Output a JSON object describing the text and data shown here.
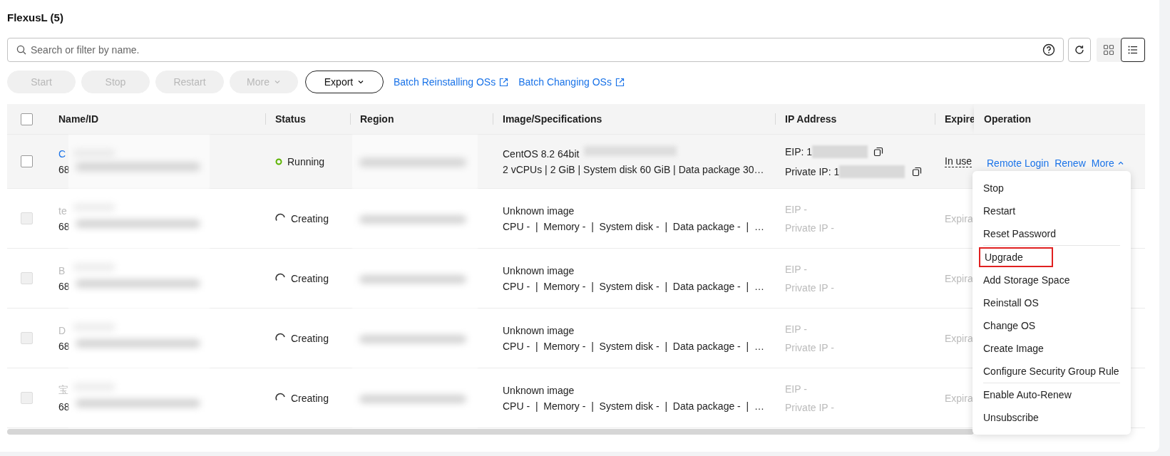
{
  "title": "FlexusL (5)",
  "search": {
    "placeholder": "Search or filter by name."
  },
  "view_toggle": [
    {
      "kind": "grid",
      "selected": false
    },
    {
      "kind": "list",
      "selected": true
    }
  ],
  "toolbar": {
    "buttons": [
      {
        "label": "Start",
        "disabled": true,
        "dropdown": false
      },
      {
        "label": "Stop",
        "disabled": true,
        "dropdown": false
      },
      {
        "label": "Restart",
        "disabled": true,
        "dropdown": false
      },
      {
        "label": "More",
        "disabled": true,
        "dropdown": true
      },
      {
        "label": "Export",
        "disabled": false,
        "dropdown": true
      }
    ],
    "links": [
      "Batch Reinstalling OSs",
      "Batch Changing OSs"
    ]
  },
  "table": {
    "select_all": {
      "checked": false
    },
    "columns": [
      "Name/ID",
      "Status",
      "Region",
      "Image/Specifications",
      "IP Address",
      "Expire",
      "Operation"
    ],
    "rows": [
      {
        "name": "C",
        "id": "68",
        "disabled": false,
        "hover": true,
        "status": {
          "kind": "running",
          "label": "Running"
        },
        "image": "CentOS 8.2 64bit",
        "specs": "2 vCPUs | 2 GiB | System disk 60 GiB | Data package 30…",
        "eip": "EIP: 1",
        "private_ip": "Private IP: 1",
        "ip_copy": true,
        "expire": "In use",
        "operations": [
          "Remote Login",
          "Renew",
          "More"
        ]
      },
      {
        "name": "te",
        "id": "68",
        "disabled": true,
        "hover": false,
        "status": {
          "kind": "creating",
          "label": "Creating"
        },
        "image": "Unknown image",
        "specs": "CPU -  |  Memory -  |  System disk -  |  Data package -  |  …",
        "eip": "EIP -",
        "private_ip": "Private IP -",
        "ip_copy": false,
        "expire": "Expira"
      },
      {
        "name": "B",
        "id": "68",
        "disabled": true,
        "hover": false,
        "status": {
          "kind": "creating",
          "label": "Creating"
        },
        "image": "Unknown image",
        "specs": "CPU -  |  Memory -  |  System disk -  |  Data package -  |  …",
        "eip": "EIP -",
        "private_ip": "Private IP -",
        "ip_copy": false,
        "expire": "Expira"
      },
      {
        "name": "D",
        "id": "68",
        "disabled": true,
        "hover": false,
        "status": {
          "kind": "creating",
          "label": "Creating"
        },
        "image": "Unknown image",
        "specs": "CPU -  |  Memory -  |  System disk -  |  Data package -  |  …",
        "eip": "EIP -",
        "private_ip": "Private IP -",
        "ip_copy": false,
        "expire": "Expira"
      },
      {
        "name": "宝",
        "id": "68",
        "disabled": true,
        "hover": false,
        "status": {
          "kind": "creating",
          "label": "Creating"
        },
        "image": "Unknown image",
        "specs": "CPU -  |  Memory -  |  System disk -  |  Data package -  |  …",
        "eip": "EIP -",
        "private_ip": "Private IP -",
        "ip_copy": false,
        "expire": "Expira"
      }
    ]
  },
  "more_menu": {
    "expanded": true,
    "items": [
      {
        "label": "Stop",
        "highlighted": false,
        "divider_after": false
      },
      {
        "label": "Restart",
        "highlighted": false,
        "divider_after": false
      },
      {
        "label": "Reset Password",
        "highlighted": false,
        "divider_after": true
      },
      {
        "label": "Upgrade",
        "highlighted": true,
        "divider_after": false
      },
      {
        "label": "Add Storage Space",
        "highlighted": false,
        "divider_after": false
      },
      {
        "label": "Reinstall OS",
        "highlighted": false,
        "divider_after": false
      },
      {
        "label": "Change OS",
        "highlighted": false,
        "divider_after": false
      },
      {
        "label": "Create Image",
        "highlighted": false,
        "divider_after": false
      },
      {
        "label": "Configure Security Group Rule",
        "highlighted": false,
        "divider_after": true
      },
      {
        "label": "Enable Auto-Renew",
        "highlighted": false,
        "divider_after": false
      },
      {
        "label": "Unsubscribe",
        "highlighted": false,
        "divider_after": false
      }
    ]
  }
}
